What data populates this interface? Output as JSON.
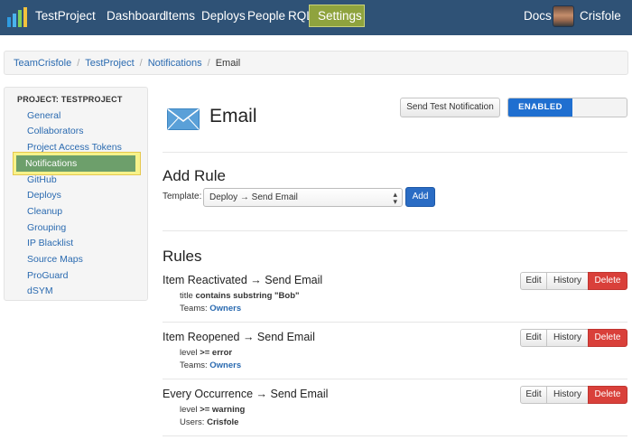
{
  "header": {
    "brand": "TestProject",
    "nav": [
      "Dashboard",
      "Items",
      "Deploys",
      "People",
      "RQL"
    ],
    "active_nav": "Settings",
    "docs": "Docs",
    "username": "Crisfole"
  },
  "breadcrumb": {
    "items": [
      "TeamCrisfole",
      "TestProject",
      "Notifications"
    ],
    "current": "Email"
  },
  "sidebar": {
    "header": "PROJECT: TESTPROJECT",
    "items": [
      "General",
      "Collaborators",
      "Project Access Tokens",
      "Notifications",
      "GitHub",
      "Deploys",
      "Cleanup",
      "Grouping",
      "IP Blacklist",
      "Source Maps",
      "ProGuard",
      "dSYM"
    ],
    "active": "Notifications"
  },
  "main": {
    "title": "Email",
    "send_test_label": "Send Test Notification",
    "toggle_label": "ENABLED",
    "add_rule_title": "Add Rule",
    "template_label": "Template:",
    "template_value": "Deploy → Send Email",
    "add_label": "Add",
    "rules_title": "Rules",
    "edit_label": "Edit",
    "history_label": "History",
    "delete_label": "Delete",
    "rules": [
      {
        "title": "Item Reactivated → Send Email",
        "cond_field": "title",
        "cond_op": "contains substring \"Bob\"",
        "target_label": "Teams:",
        "target_value": "Owners"
      },
      {
        "title": "Item Reopened → Send Email",
        "cond_field": "level",
        "cond_op": ">= error",
        "target_label": "Teams:",
        "target_value": "Owners"
      },
      {
        "title": "Every Occurrence → Send Email",
        "cond_field": "level",
        "cond_op": ">= warning",
        "target_label": "Users:",
        "target_value": "Crisfole"
      }
    ]
  },
  "icons": {
    "logo": "rollbar-logo-icon",
    "email": "envelope-icon",
    "select": "updown-arrows-icon"
  },
  "colors": {
    "navbar": "#2f5276",
    "active_nav": "#8fa33e",
    "link": "#2a6ab0",
    "enabled": "#1f6fd0",
    "delete": "#d9403a",
    "add": "#2a6cc4"
  }
}
